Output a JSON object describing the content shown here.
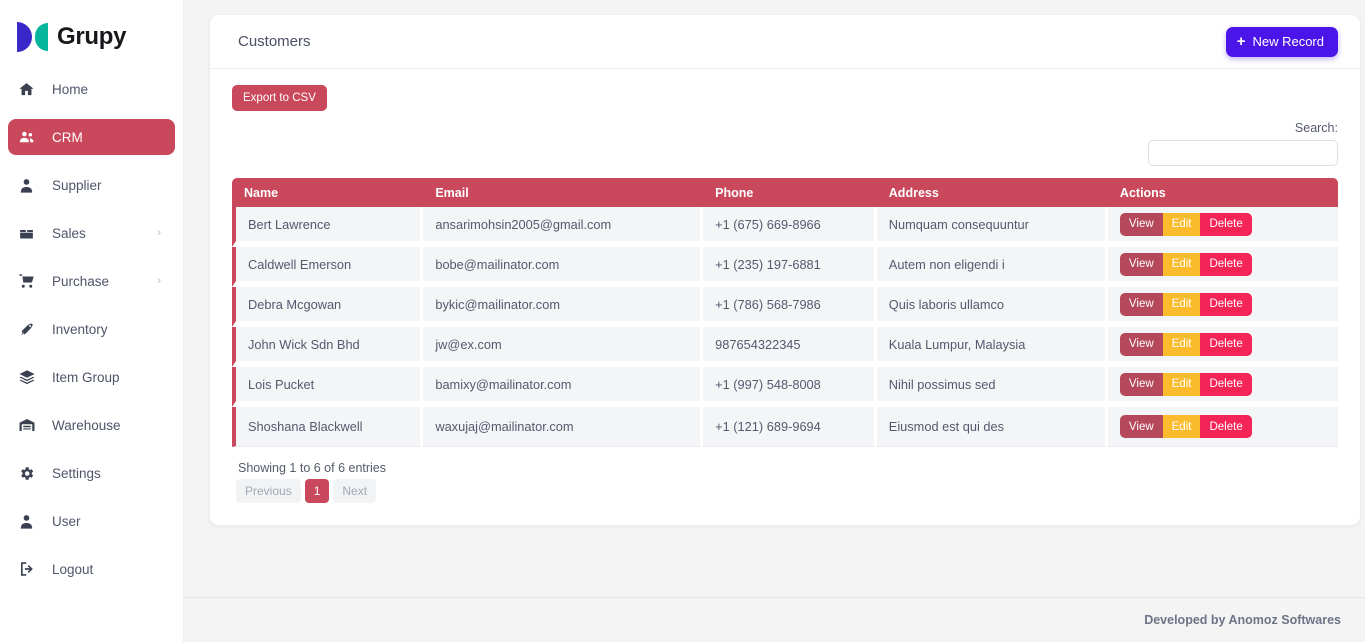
{
  "brand": {
    "name": "Grupy",
    "mark_primary": "#3a27c8",
    "mark_secondary": "#05b59c"
  },
  "sidebar": {
    "items": [
      {
        "label": "Home",
        "icon": "home-icon",
        "active": false,
        "has_chevron": false
      },
      {
        "label": "CRM",
        "icon": "users-icon",
        "active": true,
        "has_chevron": false
      },
      {
        "label": "Supplier",
        "icon": "person-icon",
        "active": false,
        "has_chevron": false
      },
      {
        "label": "Sales",
        "icon": "box-icon",
        "active": false,
        "has_chevron": true
      },
      {
        "label": "Purchase",
        "icon": "cart-icon",
        "active": false,
        "has_chevron": true
      },
      {
        "label": "Inventory",
        "icon": "tag-icon",
        "active": false,
        "has_chevron": false
      },
      {
        "label": "Item Group",
        "icon": "layers-icon",
        "active": false,
        "has_chevron": false
      },
      {
        "label": "Warehouse",
        "icon": "warehouse-icon",
        "active": false,
        "has_chevron": false
      },
      {
        "label": "Settings",
        "icon": "gear-icon",
        "active": false,
        "has_chevron": false
      },
      {
        "label": "User",
        "icon": "person-icon",
        "active": false,
        "has_chevron": false
      },
      {
        "label": "Logout",
        "icon": "logout-icon",
        "active": false,
        "has_chevron": false
      }
    ],
    "active_color": "#c9485b"
  },
  "header": {
    "title": "Customers",
    "new_record_label": "New Record",
    "new_record_color": "#4b14e8"
  },
  "toolbar": {
    "export_label": "Export to CSV",
    "export_color": "#c9485b",
    "search_label": "Search:",
    "search_value": "",
    "search_placeholder": ""
  },
  "table": {
    "header_color": "#c9485b",
    "columns": [
      "Name",
      "Email",
      "Phone",
      "Address",
      "Actions"
    ],
    "action_labels": {
      "view": "View",
      "edit": "Edit",
      "delete": "Delete"
    },
    "action_colors": {
      "view": "#b5485a",
      "edit": "#fbbb2c",
      "delete": "#f52457"
    },
    "rows": [
      {
        "name": "Bert Lawrence",
        "email": "ansarimohsin2005@gmail.com",
        "phone": "+1 (675) 669-8966",
        "address": "Numquam consequuntur"
      },
      {
        "name": "Caldwell Emerson",
        "email": "bobe@mailinator.com",
        "phone": "+1 (235) 197-6881",
        "address": "Autem non eligendi i"
      },
      {
        "name": "Debra Mcgowan",
        "email": "bykic@mailinator.com",
        "phone": "+1 (786) 568-7986",
        "address": "Quis laboris ullamco"
      },
      {
        "name": "John Wick Sdn Bhd",
        "email": "jw@ex.com",
        "phone": "987654322345",
        "address": "Kuala Lumpur, Malaysia"
      },
      {
        "name": "Lois Pucket",
        "email": "bamixy@mailinator.com",
        "phone": "+1 (997) 548-8008",
        "address": "Nihil possimus sed"
      },
      {
        "name": "Shoshana Blackwell",
        "email": "waxujaj@mailinator.com",
        "phone": "+1 (121) 689-9694",
        "address": "Eiusmod est qui des"
      }
    ]
  },
  "pagination": {
    "showing_text": "Showing 1 to 6 of 6 entries",
    "previous_label": "Previous",
    "next_label": "Next",
    "pages": [
      "1"
    ],
    "current_page": "1"
  },
  "footer": {
    "text": "Developed by Anomoz Softwares"
  }
}
